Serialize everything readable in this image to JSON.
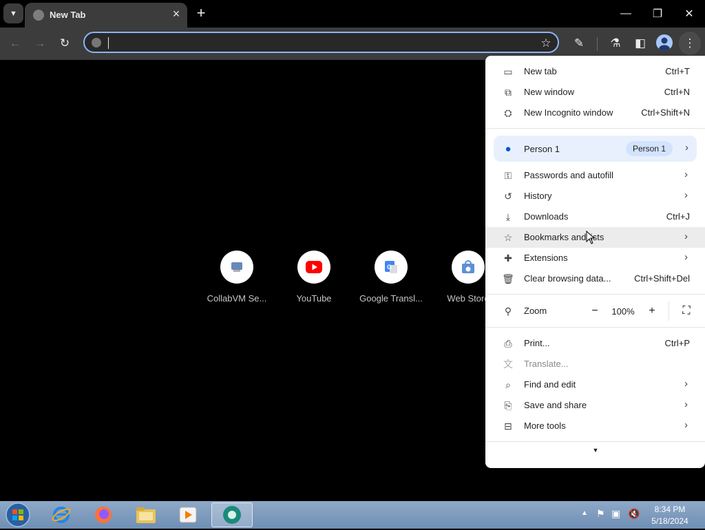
{
  "browser": {
    "tab": {
      "title": "New Tab"
    },
    "omnibox": {
      "value": "",
      "placeholder": ""
    }
  },
  "shortcuts": [
    {
      "label": "CollabVM Se...",
      "icon": "collabvm-icon"
    },
    {
      "label": "YouTube",
      "icon": "youtube-icon"
    },
    {
      "label": "Google Transl...",
      "icon": "google-translate-icon"
    },
    {
      "label": "Web Store",
      "icon": "web-store-icon"
    }
  ],
  "menu": {
    "section1": [
      {
        "label": "New tab",
        "shortcut": "Ctrl+T",
        "icon": "new-tab-icon"
      },
      {
        "label": "New window",
        "shortcut": "Ctrl+N",
        "icon": "new-window-icon"
      },
      {
        "label": "New Incognito window",
        "shortcut": "Ctrl+Shift+N",
        "icon": "incognito-icon"
      }
    ],
    "profile": {
      "label": "Person 1",
      "badge": "Person 1"
    },
    "section2": [
      {
        "label": "Passwords and autofill",
        "icon": "key-icon"
      },
      {
        "label": "History",
        "icon": "history-icon"
      },
      {
        "label": "Downloads",
        "shortcut": "Ctrl+J",
        "icon": "download-icon"
      },
      {
        "label": "Bookmarks and lists",
        "icon": "star-icon"
      },
      {
        "label": "Extensions",
        "icon": "puzzle-icon"
      },
      {
        "label": "Clear browsing data...",
        "shortcut": "Ctrl+Shift+Del",
        "icon": "trash-icon"
      }
    ],
    "zoom": {
      "label": "Zoom",
      "value": "100%"
    },
    "section3": [
      {
        "label": "Print...",
        "shortcut": "Ctrl+P",
        "icon": "print-icon"
      },
      {
        "label": "Translate...",
        "icon": "translate-icon",
        "disabled": true
      },
      {
        "label": "Find and edit",
        "icon": "find-icon"
      },
      {
        "label": "Save and share",
        "icon": "save-share-icon"
      },
      {
        "label": "More tools",
        "icon": "toolbox-icon"
      }
    ]
  },
  "taskbar": {
    "clock_time": "8:34 PM",
    "clock_date": "5/18/2024"
  },
  "colors": {
    "accent": "#8ab4f8",
    "profile_highlight": "#e8f0fe",
    "toolbar": "#3c3c3c"
  }
}
